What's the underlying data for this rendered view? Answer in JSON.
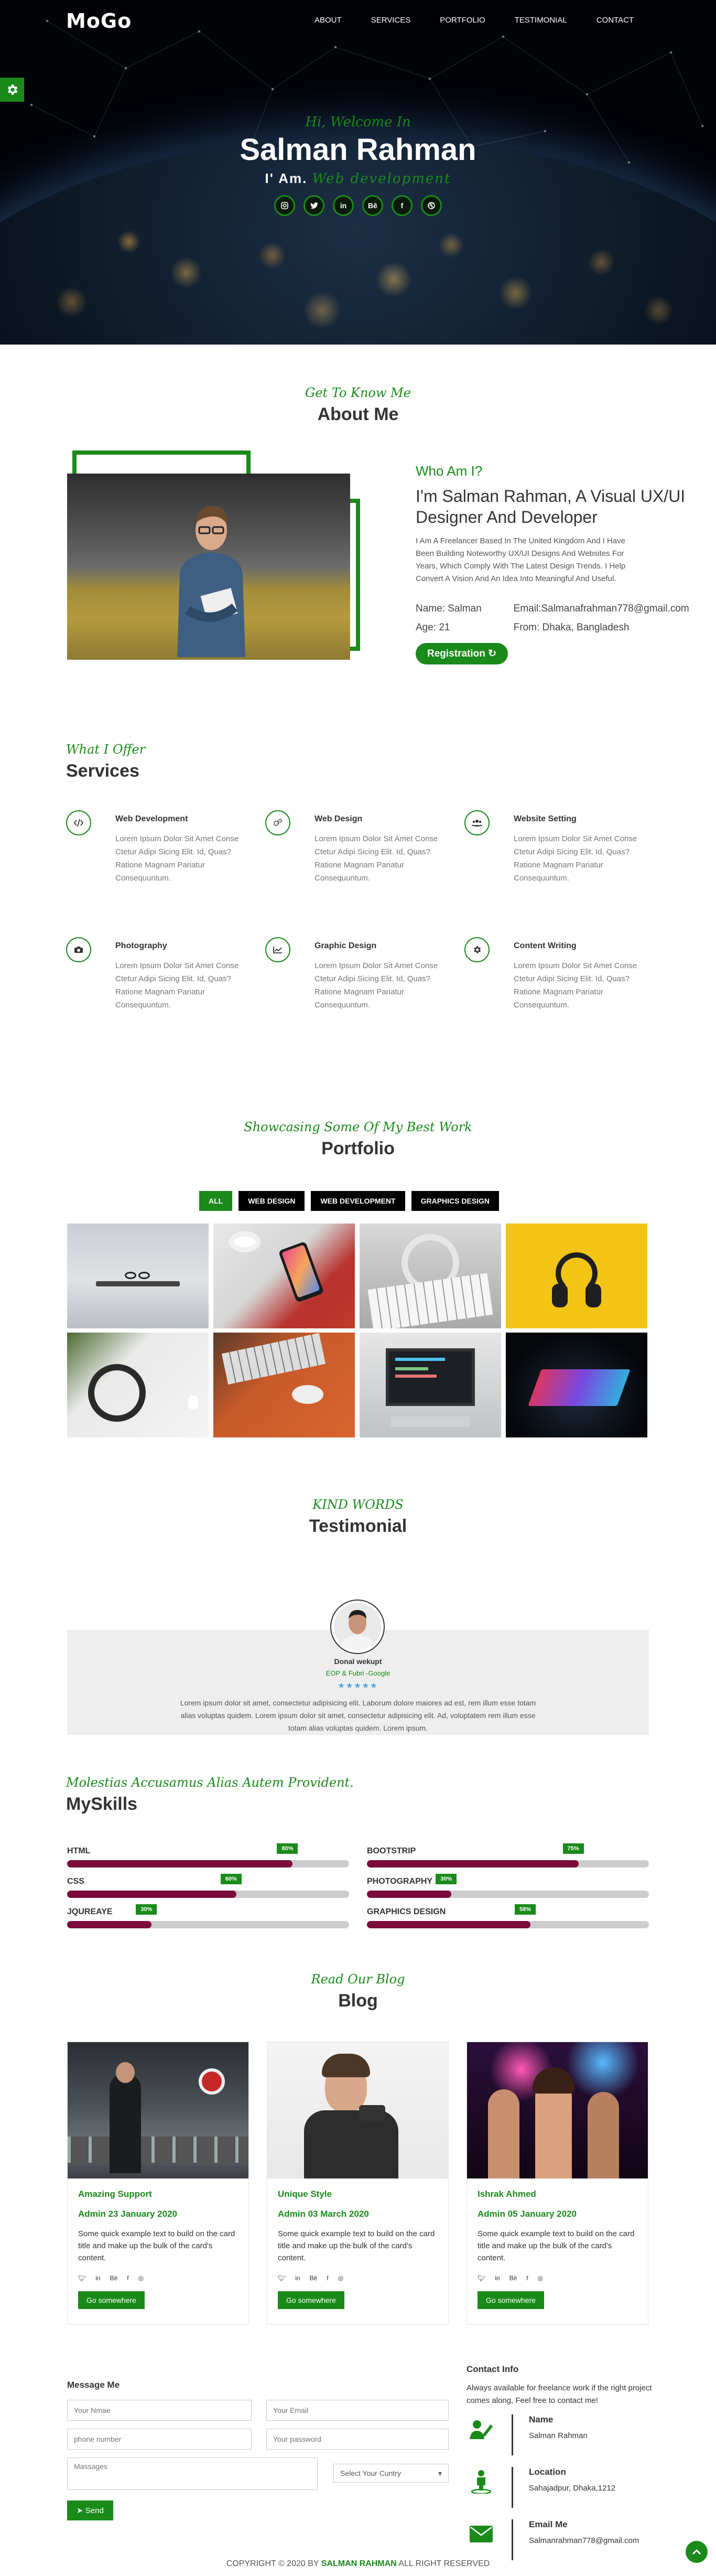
{
  "nav": {
    "logo": "MoGo",
    "items": [
      "ABOUT",
      "SERVICES",
      "PORTFOLIO",
      "TESTIMONIAL",
      "CONTACT"
    ]
  },
  "hero": {
    "greeting": "Hi, Welcome In",
    "name": "Salman Rahman",
    "role_prefix": "I' Am.",
    "role_highlight": "Web development",
    "social": [
      "instagram-icon",
      "twitter-icon",
      "linkedin-icon",
      "behance-icon",
      "facebook-icon",
      "dribbble-icon"
    ]
  },
  "about": {
    "kicker": "Get To Know Me",
    "title": "About Me",
    "who": "Who Am I?",
    "headline": "I'm Salman Rahman, A Visual UX/UI Designer And Developer",
    "description": "I Am A Freelancer Based In The United Kingdom And I Have Been Building Noteworthy UX/UI Designs And Websites For Years, Which Comply With The Latest Design Trends. I Help Convert A Vision And An Idea Into Meaningful And Useful.",
    "name_label": "Name:  Salman",
    "email_label": "Email:Salmanafrahman778@gmail.com",
    "age_label": "Age:   21",
    "from_label": "From: Dhaka, Bangladesh",
    "button": "Registration"
  },
  "services": {
    "kicker": "What I Offer",
    "title": "Services",
    "items": [
      {
        "title": "Web Development",
        "text": "Lorem Ipsum Dolor Sit Amet Conse Ctetur Adipi Sicing Elit. Id, Quas? Ratione Magnam Pariatur Consequuntum.",
        "icon": "code-icon"
      },
      {
        "title": "Web Design",
        "text": "Lorem Ipsum Dolor Sit Amet Conse Ctetur Adipi Sicing Elit. Id, Quas? Ratione Magnam Pariatur Consequuntum.",
        "icon": "cogs-icon"
      },
      {
        "title": "Website Setting",
        "text": "Lorem Ipsum Dolor Sit Amet Conse Ctetur Adipi Sicing Elit. Id, Quas? Ratione Magnam Pariatur Consequuntum.",
        "icon": "users-icon"
      },
      {
        "title": "Photography",
        "text": "Lorem Ipsum Dolor Sit Amet Conse Ctetur Adipi Sicing Elit. Id, Quas? Ratione Magnam Pariatur Consequuntum.",
        "icon": "camera-icon"
      },
      {
        "title": "Graphic Design",
        "text": "Lorem Ipsum Dolor Sit Amet Conse Ctetur Adipi Sicing Elit. Id, Quas? Ratione Magnam Pariatur Consequuntum.",
        "icon": "chart-icon"
      },
      {
        "title": "Content Writing",
        "text": "Lorem Ipsum Dolor Sit Amet Conse Ctetur Adipi Sicing Elit. Id, Quas? Ratione Magnam Pariatur Consequuntum.",
        "icon": "gear-icon"
      }
    ]
  },
  "portfolio": {
    "kicker": "Showcasing Some Of My Best Work",
    "title": "Portfolio",
    "filters": [
      "ALL",
      "WEB DESIGN",
      "WEB DEVELOPMENT",
      "GRAPHICS DESIGN"
    ],
    "active_filter": "ALL"
  },
  "testimonial": {
    "kicker": "KIND WORDS",
    "title": "Testimonial",
    "name": "Donal wekupt",
    "role": "EOP & Fubri -Google",
    "stars": "★★★★★",
    "quote": "Lorem ipsum dolor sit amet, consectetur adipisicing elit. Laborum dolore maiores ad est, rem illum esse totam alias voluptas quidem. Lorem ipsum dolor sit amet, consectetur adipisicing elit. Ad, voluptatem rem illum esse totam alias voluptas quidem. Lorem ipsum."
  },
  "skills": {
    "kicker": "Molestias Accusamus Alias Autem Provident.",
    "title": "MySkills",
    "left": [
      {
        "label": "HTML",
        "percent": 80
      },
      {
        "label": "CSS",
        "percent": 60
      },
      {
        "label": "JQUREAYE",
        "percent": 30
      }
    ],
    "right": [
      {
        "label": "BOOTSTRIP",
        "percent": 75
      },
      {
        "label": "PHOTOGRAPHY",
        "percent": 30
      },
      {
        "label": "GRAPHICS DESIGN",
        "percent": 58
      }
    ]
  },
  "blog": {
    "kicker": "Read Our Blog",
    "title": "Blog",
    "posts": [
      {
        "title": "Amazing Support",
        "meta": "Admin 23 January 2020",
        "text": "Some quick example text to build on the card title and make up the bulk of the card's content.",
        "button": "Go somewhere"
      },
      {
        "title": "Unique Style",
        "meta": "Admin 03 March 2020",
        "text": "Some quick example text to build on the card title and make up the bulk of the card's content.",
        "button": "Go somewhere"
      },
      {
        "title": "Ishrak Ahmed",
        "meta": "Admin 05 January 2020",
        "text": "Some quick example text to build on the card title and make up the bulk of the card's content.",
        "button": "Go somewhere"
      }
    ]
  },
  "contact": {
    "title": "Message Me",
    "name_ph": "Your Nmae",
    "email_ph": "Your Email",
    "phone_ph": "phone number",
    "password_ph": "Your password",
    "message_ph": "Massages",
    "country_ph": "Select Your Cuntry",
    "send": "Send",
    "info_title": "Contact Info",
    "info_text": "Always available for freelance work if the right project comes along, Feel free to contact me!",
    "name_label": "Name",
    "name_val": "Salman Rahman",
    "loc_label": "Location",
    "loc_val": "Sahajadpur, Dhaka,1212",
    "email_label": "Email Me",
    "email_val": "Salmanrahman778@gmail.com"
  },
  "footer": {
    "prefix": "COPYRIGHT © 2020 BY ",
    "name": "SALMAN RAHMAN",
    "suffix": " ALL RIGHT RESERVED"
  },
  "colors": {
    "accent": "#1a8a1a",
    "skill_bar": "#7a0b3a"
  }
}
